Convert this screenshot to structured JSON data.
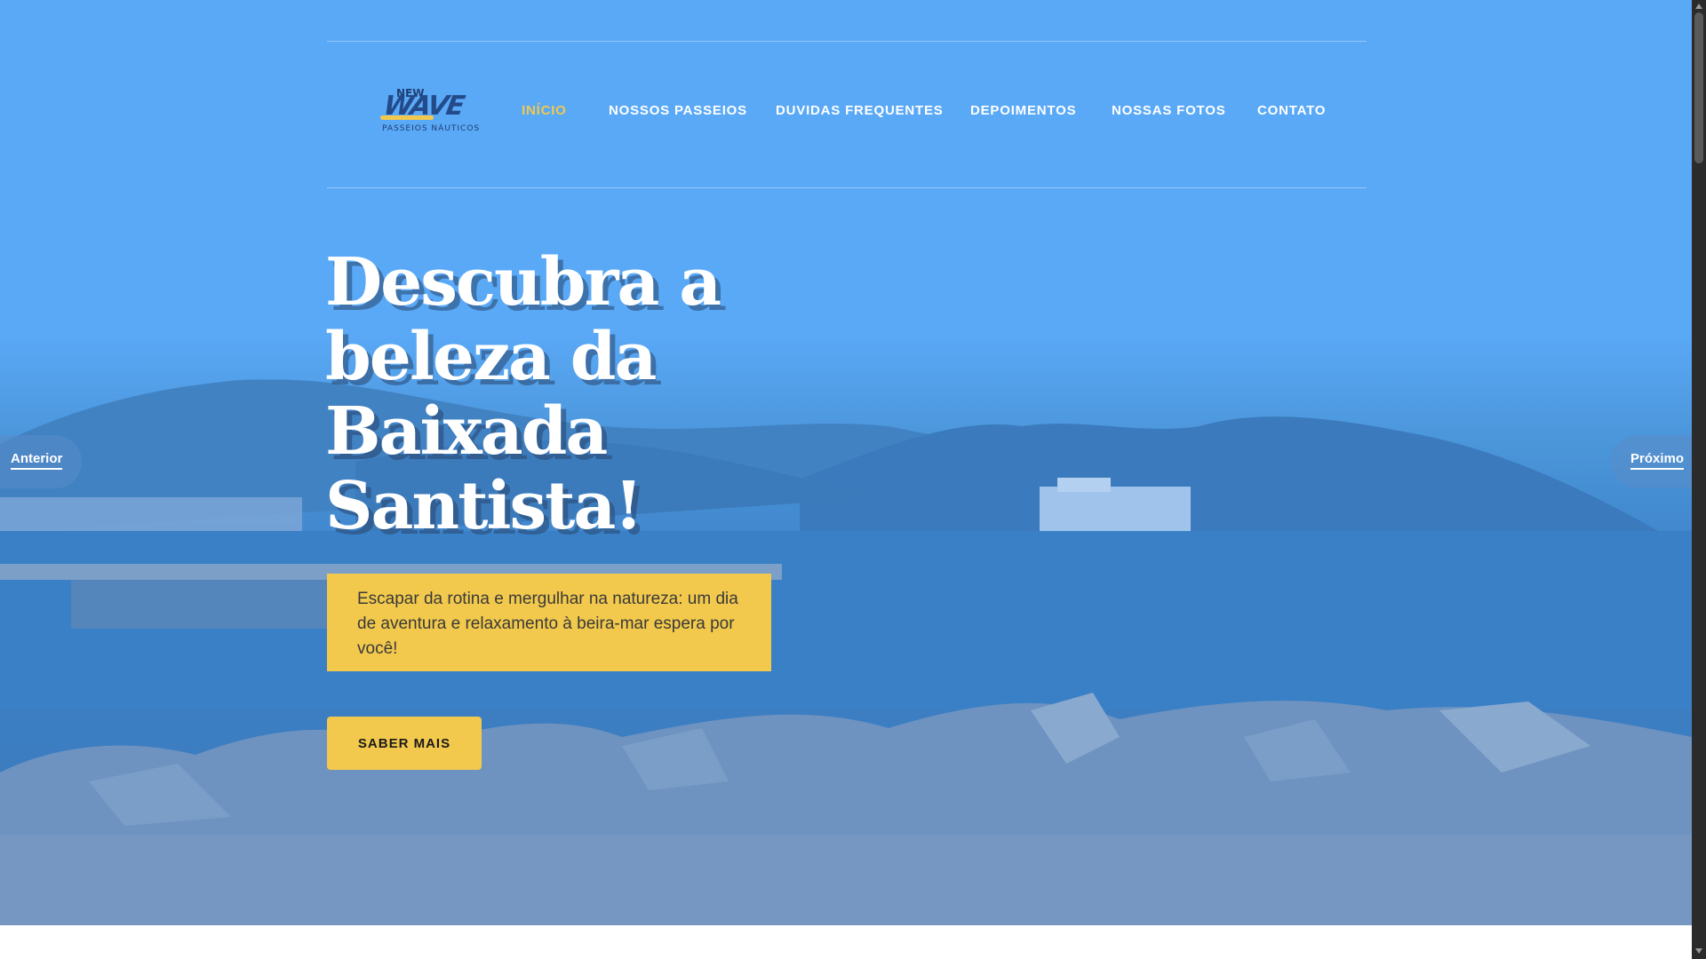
{
  "brand": {
    "logo_word": "WAVE",
    "logo_top": "NEW",
    "logo_sub": "PASSEIOS NÁUTICOS"
  },
  "nav": {
    "items": [
      {
        "label": "INÍCIO",
        "active": true
      },
      {
        "label": "NOSSOS PASSEIOS",
        "active": false
      },
      {
        "label": "DUVIDAS FREQUENTES",
        "active": false
      },
      {
        "label": "DEPOIMENTOS",
        "active": false
      },
      {
        "label": "NOSSAS FOTOS",
        "active": false
      },
      {
        "label": "CONTATO",
        "active": false
      }
    ]
  },
  "hero": {
    "title": "Descubra a beleza da Baixada Santista!",
    "description": "Escapar da rotina e mergulhar na natureza: um dia de aventura e relaxamento à beira-mar espera por você!",
    "cta_label": "SABER MAIS"
  },
  "slider": {
    "prev_label": "Anterior",
    "next_label": "Próximo"
  },
  "colors": {
    "accent": "#f2c94c",
    "hero_overlay": "#5aa9f7",
    "text_light": "#ffffff"
  }
}
